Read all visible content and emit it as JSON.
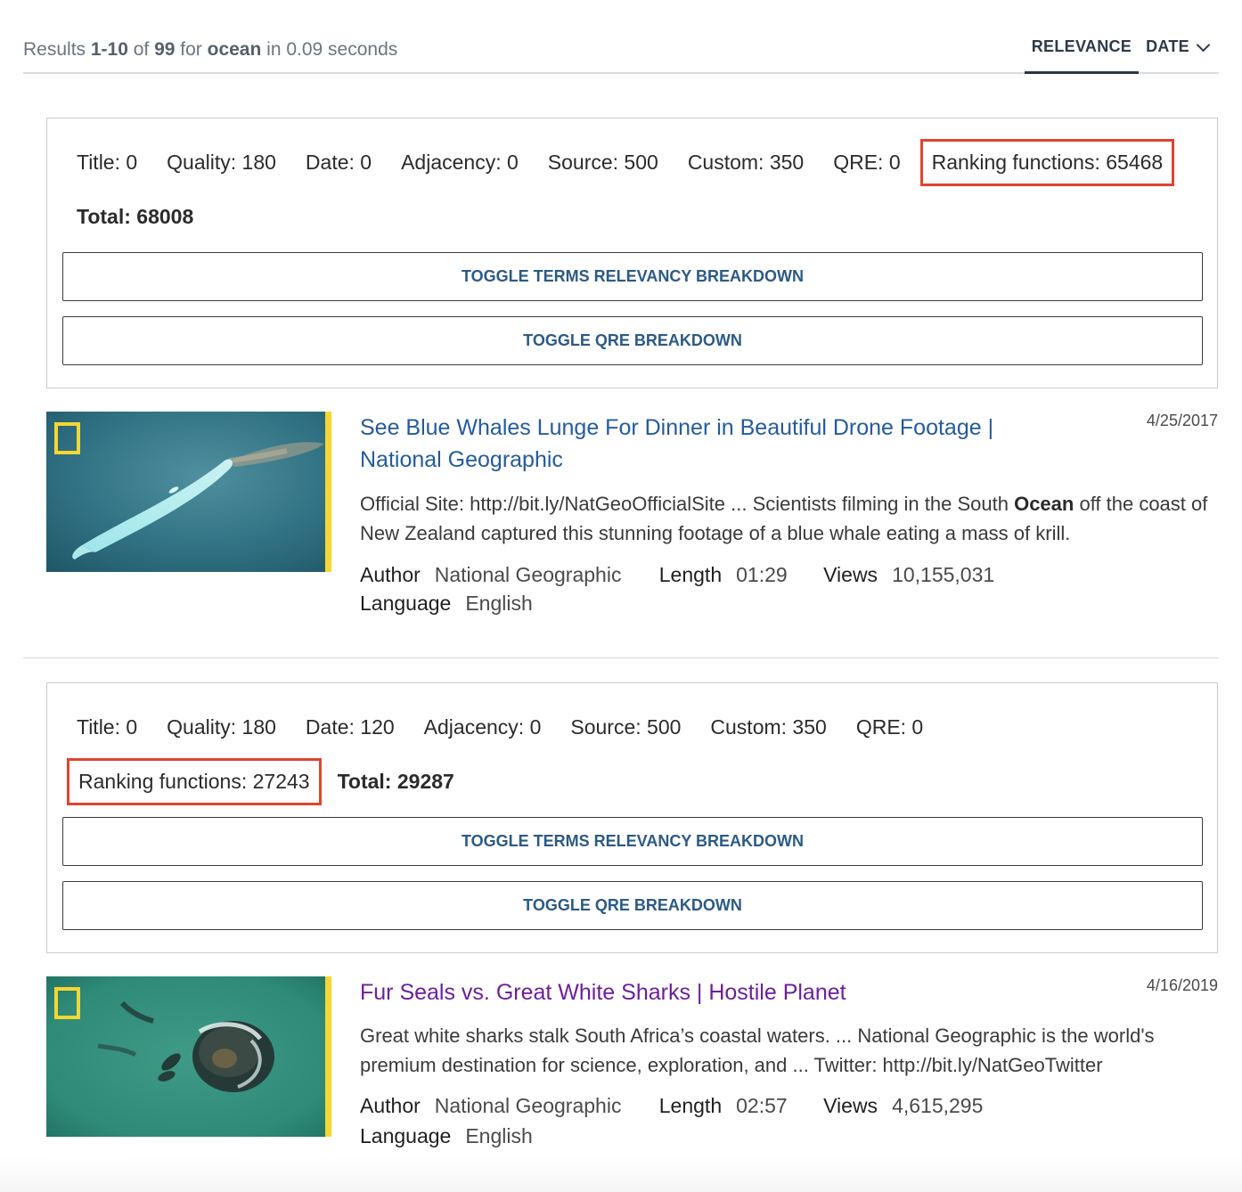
{
  "summary": {
    "prefix": "Results ",
    "range": "1-10",
    "of": " of ",
    "total": "99",
    "for": " for ",
    "query": "ocean",
    "suffix": " in 0.09 seconds"
  },
  "sort": {
    "relevance_label": "RELEVANCE",
    "date_label": "DATE"
  },
  "results": [
    {
      "debug": {
        "title": "Title: 0",
        "quality": "Quality: 180",
        "date": "Date: 0",
        "adjacency": "Adjacency: 0",
        "source": "Source: 500",
        "custom": "Custom: 350",
        "qre": "QRE: 0",
        "ranking": "Ranking functions: 65468",
        "total": "Total: 68008",
        "toggle_terms": "TOGGLE TERMS RELEVANCY BREAKDOWN",
        "toggle_qre": "TOGGLE QRE BREAKDOWN"
      },
      "title": "See Blue Whales Lunge For Dinner in Beautiful Drone Footage | National Geographic",
      "date": "4/25/2017",
      "snippet_before": "Official Site: http://bit.ly/NatGeoOfficialSite ... Scientists filming in the South ",
      "snippet_bold": "Ocean",
      "snippet_after": " off the coast of New Zealand captured this stunning footage of a blue whale eating a mass of krill.",
      "author_label": "Author",
      "author": "National Geographic",
      "length_label": "Length",
      "length": "01:29",
      "views_label": "Views",
      "views": "10,155,031",
      "language_label": "Language",
      "language": "English"
    },
    {
      "debug": {
        "title": "Title: 0",
        "quality": "Quality: 180",
        "date": "Date: 120",
        "adjacency": "Adjacency: 0",
        "source": "Source: 500",
        "custom": "Custom: 350",
        "qre": "QRE: 0",
        "ranking": "Ranking functions: 27243",
        "total": "Total: 29287",
        "toggle_terms": "TOGGLE TERMS RELEVANCY BREAKDOWN",
        "toggle_qre": "TOGGLE QRE BREAKDOWN"
      },
      "title": "Fur Seals vs. Great White Sharks | Hostile Planet",
      "date": "4/16/2019",
      "snippet": "Great white sharks stalk South Africa’s coastal waters. ... National Geographic is the world's premium destination for science, exploration, and ... Twitter: http://bit.ly/NatGeoTwitter",
      "author_label": "Author",
      "author": "National Geographic",
      "length_label": "Length",
      "length": "02:57",
      "views_label": "Views",
      "views": "4,615,295",
      "language_label": "Language",
      "language": "English"
    }
  ],
  "colors": {
    "link": "#245b9e",
    "visited_link": "#6c1f9b",
    "button_text": "#2c5a86",
    "highlight_box": "#e0442f",
    "thumb_border": "#f6d631"
  }
}
